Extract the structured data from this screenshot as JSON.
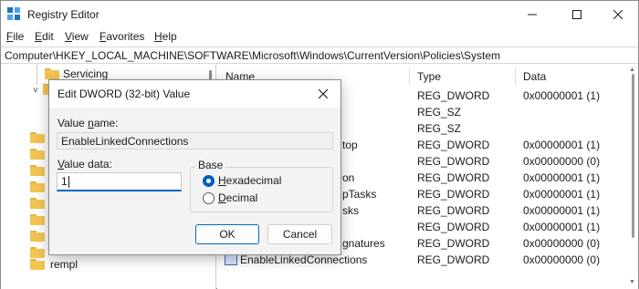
{
  "window": {
    "title": "Registry Editor",
    "controls": {
      "minimize": "minimize-icon",
      "maximize": "maximize-icon",
      "close": "close-icon"
    }
  },
  "menu": {
    "items": [
      {
        "first": "F",
        "rest": "ile"
      },
      {
        "first": "E",
        "rest": "dit"
      },
      {
        "first": "V",
        "rest": "iew"
      },
      {
        "first": "F",
        "rest": "avorites"
      },
      {
        "first": "H",
        "rest": "elp"
      }
    ]
  },
  "address": {
    "path": "Computer\\HKEY_LOCAL_MACHINE\\SOFTWARE\\Microsoft\\Windows\\CurrentVersion\\Policies\\System"
  },
  "tree": {
    "items": [
      {
        "label": "Servicing"
      },
      {
        "label": "rempl"
      }
    ]
  },
  "list": {
    "headers": {
      "name": "Name",
      "type": "Type",
      "data": "Data"
    },
    "rows": [
      {
        "name": "",
        "type": "REG_DWORD",
        "data": "0x00000001 (1)"
      },
      {
        "name": "",
        "type": "REG_SZ",
        "data": ""
      },
      {
        "name": "",
        "type": "REG_SZ",
        "data": ""
      },
      {
        "name": "top",
        "type": "REG_DWORD",
        "data": "0x00000001 (1)"
      },
      {
        "name": "",
        "type": "REG_DWORD",
        "data": "0x00000000 (0)"
      },
      {
        "name": "on",
        "type": "REG_DWORD",
        "data": "0x00000001 (1)"
      },
      {
        "name": "pTasks",
        "type": "REG_DWORD",
        "data": "0x00000001 (1)"
      },
      {
        "name": "sks",
        "type": "REG_DWORD",
        "data": "0x00000001 (1)"
      },
      {
        "name": "",
        "type": "REG_DWORD",
        "data": "0x00000001 (1)"
      },
      {
        "name": "gnatures",
        "type": "REG_DWORD",
        "data": "0x00000000 (0)"
      },
      {
        "name": "EnableLinkedConnections",
        "type": "REG_DWORD",
        "data": "0x00000000 (0)"
      }
    ]
  },
  "dialog": {
    "title": "Edit DWORD (32-bit) Value",
    "value_name_label_first": "Value ",
    "value_name_label_ul": "n",
    "value_name_label_rest": "ame:",
    "value_name": "EnableLinkedConnections",
    "value_data_label_first": "",
    "value_data_label_ul": "V",
    "value_data_label_rest": "alue data:",
    "value_data": "1",
    "base_label": "Base",
    "radio_hex_ul": "H",
    "radio_hex_rest": "exadecimal",
    "radio_dec_ul": "D",
    "radio_dec_rest": "ecimal",
    "base_selected": "Hexadecimal",
    "ok_label": "OK",
    "cancel_label": "Cancel"
  },
  "colors": {
    "accent": "#0067c0",
    "folder": "#f3c452",
    "dialog_bg": "#f3f3f3"
  }
}
